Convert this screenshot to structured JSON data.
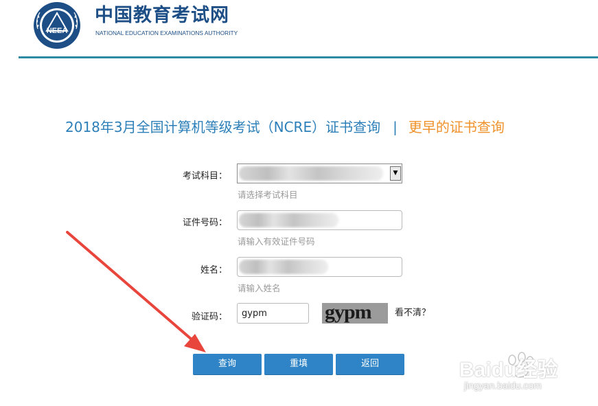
{
  "header": {
    "logo_text": "NEEA",
    "brand_cn": "中国教育考试网",
    "brand_en": "NATIONAL EDUCATION EXAMINATIONS AUTHORITY"
  },
  "title": {
    "main": "2018年3月全国计算机等级考试（NCRE）证书查询",
    "separator": "|",
    "earlier_link": "更早的证书查询"
  },
  "form": {
    "subject": {
      "label": "考试科目：",
      "hint": "请选择考试科目",
      "arrow": "▼"
    },
    "id_number": {
      "label": "证件号码：",
      "hint": "请输入有效证件号码"
    },
    "name": {
      "label": "姓名：",
      "hint": "请输入姓名"
    },
    "captcha": {
      "label": "验证码：",
      "value": "gypm",
      "image_text": "gypm",
      "refresh_label": "看不清？"
    }
  },
  "buttons": {
    "query": "查询",
    "reset": "重填",
    "back": "返回"
  },
  "watermark": {
    "brand": "Baidu经验",
    "url": "jingyan.baidu.com"
  },
  "colors": {
    "brand_blue": "#1d4f86",
    "rule_teal": "#2e8aa4",
    "title_blue": "#2c7fb8",
    "link_orange": "#f0922b",
    "button_blue": "#2e84c6",
    "annotation_red": "#e8453c"
  }
}
